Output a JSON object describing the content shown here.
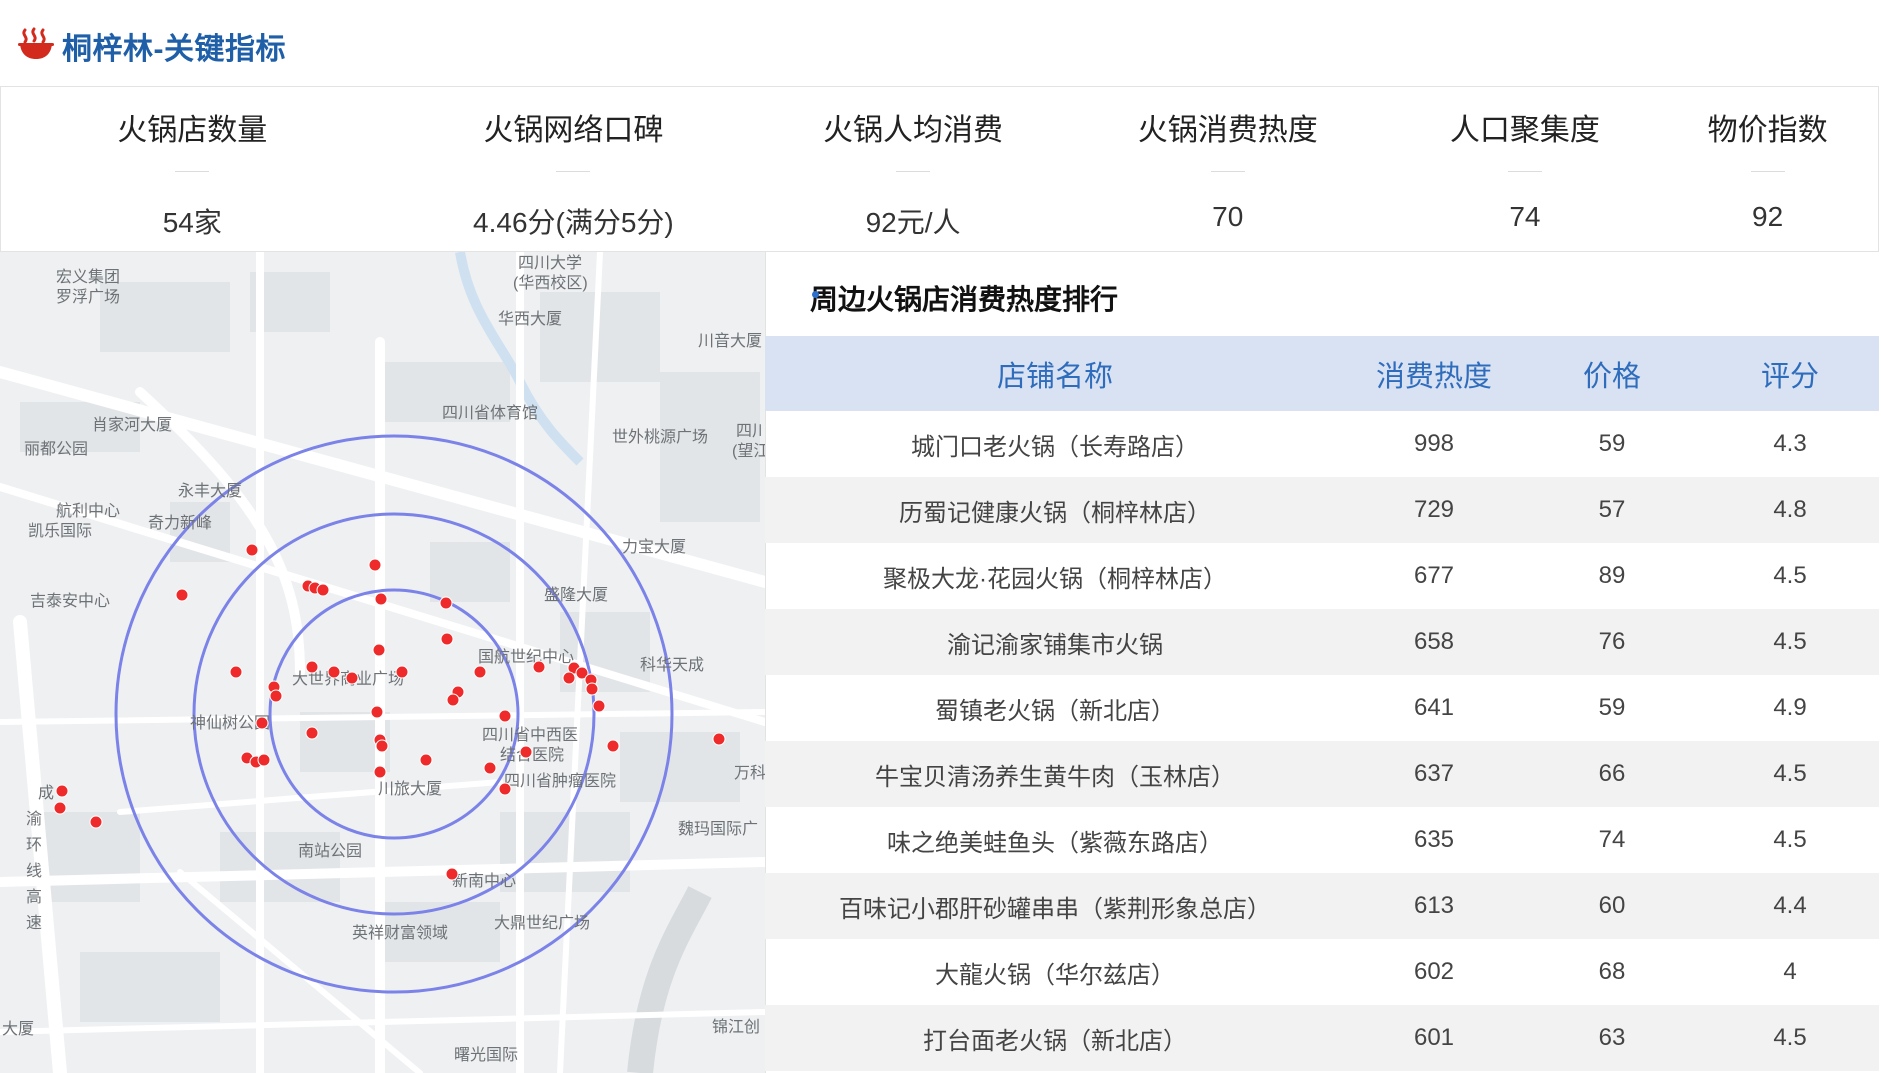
{
  "header": {
    "title": "桐梓林-关键指标",
    "icon": "hotpot-logo-icon",
    "icon_color": "#d22a1d"
  },
  "kpis": [
    {
      "label": "火锅店数量",
      "value": "54家"
    },
    {
      "label": "火锅网络口碑",
      "value": "4.46分(满分5分)"
    },
    {
      "label": "火锅人均消费",
      "value": "92元/人"
    },
    {
      "label": "火锅消费热度",
      "value": "70"
    },
    {
      "label": "人口聚集度",
      "value": "74"
    },
    {
      "label": "物价指数",
      "value": "92"
    }
  ],
  "map": {
    "labels": [
      "宏义集团",
      "罗浮广场",
      "四川大学",
      "(华西校区)",
      "华西大厦",
      "川音大厦",
      "四川省体育馆",
      "肖家河大厦",
      "丽都公园",
      "世外桃源广场",
      "四川",
      "(望江",
      "永丰大厦",
      "航利中心",
      "凯乐国际",
      "奇力新峰",
      "力宝大厦",
      "盛隆大厦",
      "吉泰安中心",
      "国航世纪中心",
      "科华天成",
      "大世界商业广场",
      "神仙树公园",
      "四川省中西医",
      "结合医院",
      "万科",
      "川旅大厦",
      "四川省肿瘤医院",
      "成",
      "渝",
      "环",
      "线",
      "高",
      "速",
      "魏玛国际广",
      "南站公园",
      "新南中心",
      "英祥财富领域",
      "大鼎世纪广场",
      "锦江创",
      "大厦",
      "曙光国际"
    ],
    "ring_color": "#7b82e8",
    "poi_color": "#ee2a2a",
    "poi_count": 54
  },
  "ranking": {
    "title": "周边火锅店消费热度排行",
    "columns": [
      "店铺名称",
      "消费热度",
      "价格",
      "评分"
    ],
    "rows": [
      {
        "name": "城门口老火锅（长寿路店）",
        "heat": "998",
        "price": "59",
        "rating": "4.3"
      },
      {
        "name": "历蜀记健康火锅（桐梓林店）",
        "heat": "729",
        "price": "57",
        "rating": "4.8"
      },
      {
        "name": "聚极大龙·花园火锅（桐梓林店）",
        "heat": "677",
        "price": "89",
        "rating": "4.5"
      },
      {
        "name": "渝记渝家铺集市火锅",
        "heat": "658",
        "price": "76",
        "rating": "4.5"
      },
      {
        "name": "蜀镇老火锅（新北店）",
        "heat": "641",
        "price": "59",
        "rating": "4.9"
      },
      {
        "name": "牛宝贝清汤养生黄牛肉（玉林店）",
        "heat": "637",
        "price": "66",
        "rating": "4.5"
      },
      {
        "name": "味之绝美蛙鱼头（紫薇东路店）",
        "heat": "635",
        "price": "74",
        "rating": "4.5"
      },
      {
        "name": "百味记小郡肝砂罐串串（紫荆形象总店）",
        "heat": "613",
        "price": "60",
        "rating": "4.4"
      },
      {
        "name": "大龍火锅（华尔兹店）",
        "heat": "602",
        "price": "68",
        "rating": "4"
      },
      {
        "name": "打台面老火锅（新北店）",
        "heat": "601",
        "price": "63",
        "rating": "4.5"
      }
    ]
  }
}
